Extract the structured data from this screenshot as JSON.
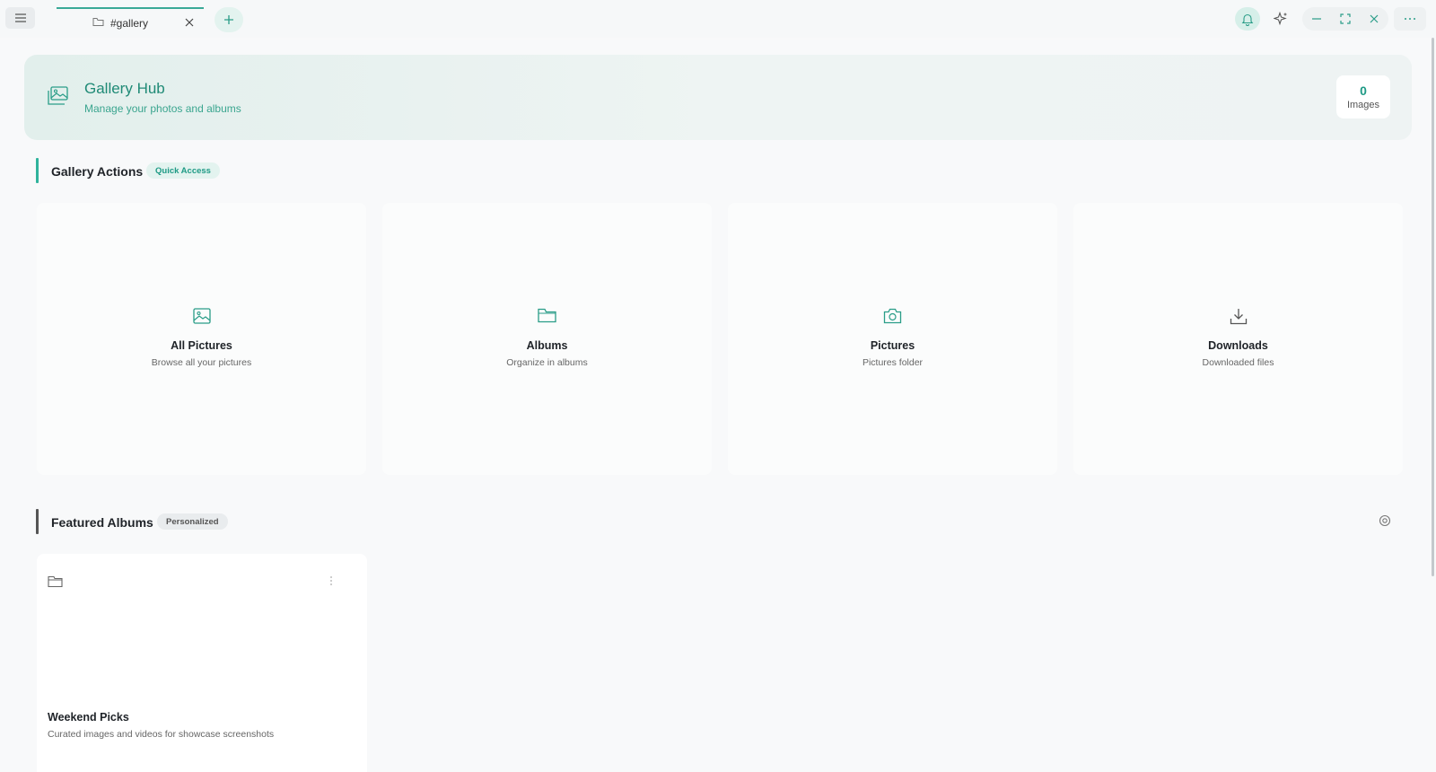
{
  "titlebar": {
    "tab_label": "#gallery"
  },
  "hub": {
    "title": "Gallery Hub",
    "subtitle": "Manage your photos and albums",
    "count": "0",
    "count_label": "Images"
  },
  "actions_section": {
    "title": "Gallery Actions",
    "badge": "Quick Access"
  },
  "actions": [
    {
      "title": "All Pictures",
      "subtitle": "Browse all your pictures",
      "icon": "image-icon"
    },
    {
      "title": "Albums",
      "subtitle": "Organize in albums",
      "icon": "folder-icon"
    },
    {
      "title": "Pictures",
      "subtitle": "Pictures folder",
      "icon": "camera-icon"
    },
    {
      "title": "Downloads",
      "subtitle": "Downloaded files",
      "icon": "download-icon"
    }
  ],
  "featured_section": {
    "title": "Featured Albums",
    "badge": "Personalized"
  },
  "albums": [
    {
      "title": "Weekend Picks",
      "subtitle": "Curated images and videos for showcase screenshots"
    }
  ],
  "colors": {
    "accent": "#1e9a85",
    "accent_light": "#e3f3ef",
    "background": "#f8f9fa"
  }
}
